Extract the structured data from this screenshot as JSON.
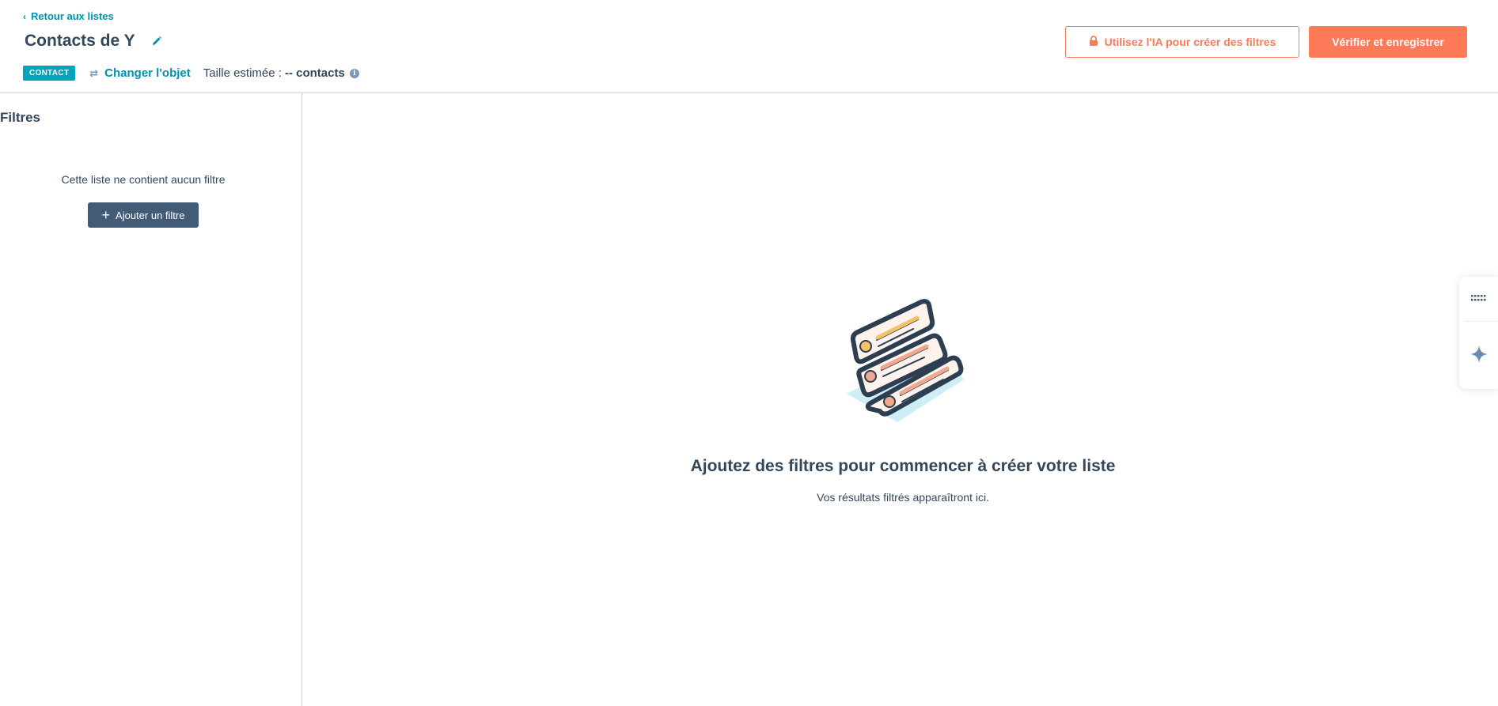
{
  "header": {
    "back_label": "Retour aux listes",
    "title": "Contacts de Y",
    "object_badge": "CONTACT",
    "change_object_label": "Changer l'objet",
    "size_label": "Taille estimée :",
    "size_value": "-- contacts",
    "ai_button_label": "Utilisez l'IA pour créer des filtres",
    "verify_button_label": "Vérifier et enregistrer"
  },
  "filters_panel": {
    "title": "Filtres",
    "empty_text": "Cette liste ne contient aucun filtre",
    "add_filter_label": "Ajouter un filtre"
  },
  "main": {
    "empty_title": "Ajoutez des filtres pour commencer à créer votre liste",
    "empty_subtitle": "Vos résultats filtrés apparaîtront ici."
  },
  "right_rail": {
    "icons": [
      "apps-grid-icon",
      "sparkle-icon"
    ]
  },
  "colors": {
    "accent_orange": "#ff7a59",
    "link_teal": "#0091ae",
    "badge_teal": "#00a4bd",
    "text_dark": "#33475b",
    "button_slate": "#425b76",
    "border": "#cbd6e2"
  }
}
